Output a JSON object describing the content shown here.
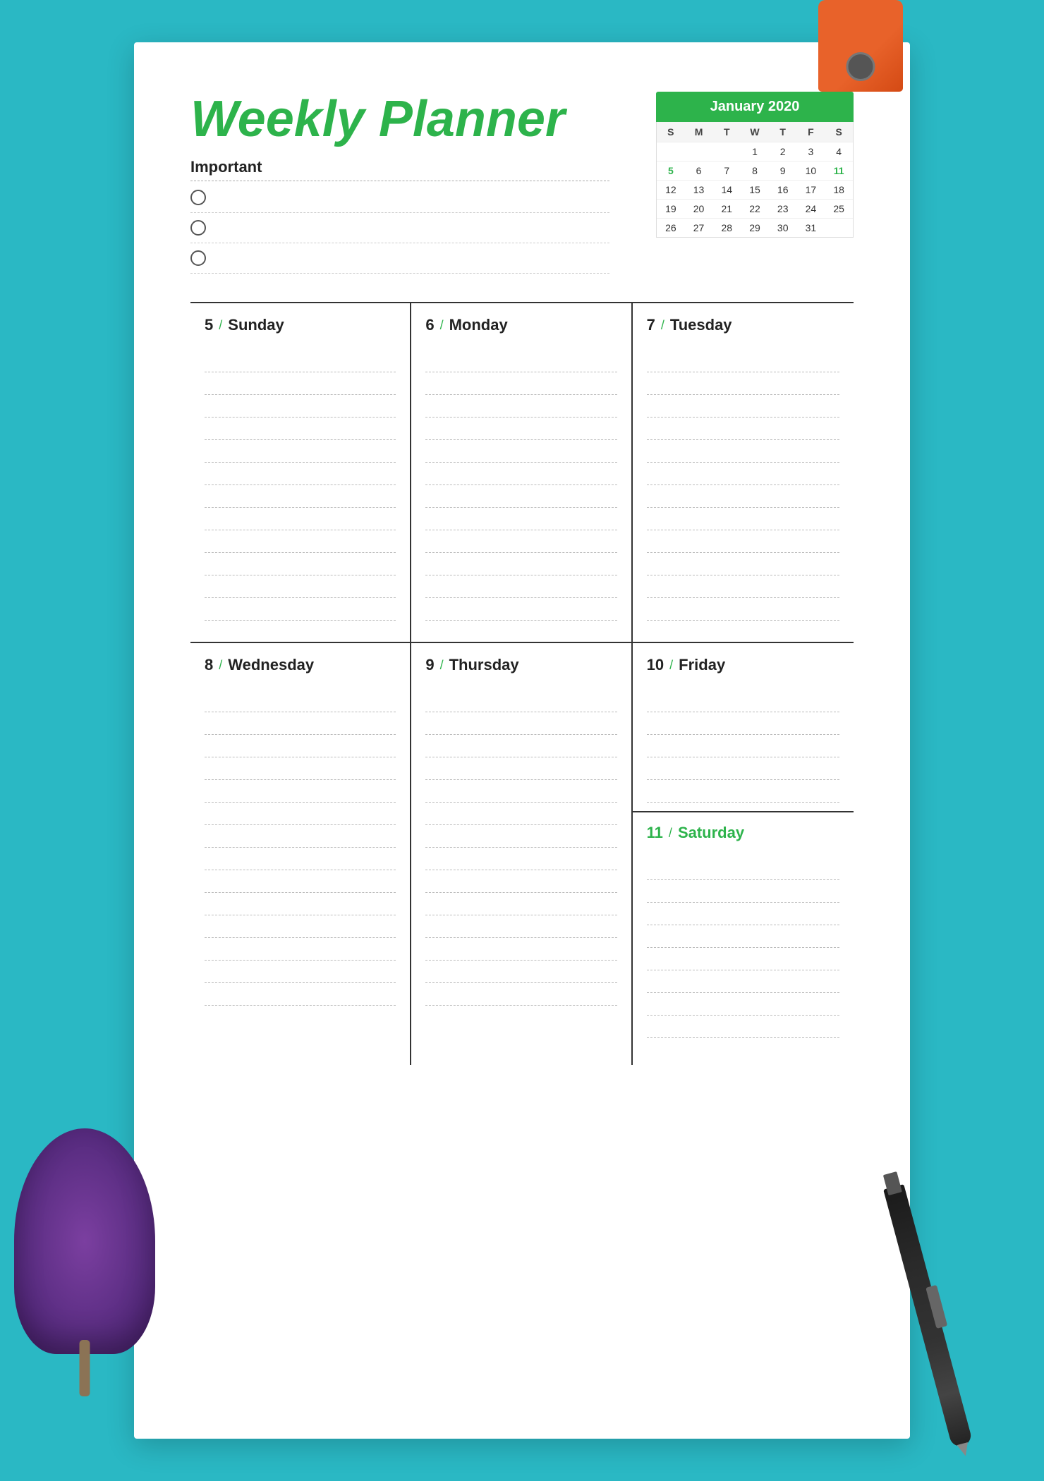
{
  "page": {
    "title": "Weekly Planner",
    "background_color": "#2ab8c4"
  },
  "header": {
    "title": "Weekly Planner",
    "important_label": "Important",
    "checkboxes": [
      {
        "id": 1,
        "checked": false
      },
      {
        "id": 2,
        "checked": false
      },
      {
        "id": 3,
        "checked": false
      }
    ]
  },
  "calendar": {
    "month_year": "January 2020",
    "day_labels": [
      "S",
      "M",
      "T",
      "W",
      "T",
      "F",
      "S"
    ],
    "weeks": [
      [
        "",
        "",
        "",
        "1",
        "2",
        "3",
        "4"
      ],
      [
        "5",
        "6",
        "7",
        "8",
        "9",
        "10",
        "11"
      ],
      [
        "12",
        "13",
        "14",
        "15",
        "16",
        "17",
        "18"
      ],
      [
        "19",
        "20",
        "21",
        "22",
        "23",
        "24",
        "25"
      ],
      [
        "26",
        "27",
        "28",
        "29",
        "30",
        "31",
        ""
      ]
    ],
    "highlighted_cells": [
      "5",
      "11"
    ]
  },
  "planner": {
    "row1": [
      {
        "day_number": "5",
        "day_name": "Sunday",
        "green": false,
        "lines": 12
      },
      {
        "day_number": "6",
        "day_name": "Monday",
        "green": false,
        "lines": 12
      },
      {
        "day_number": "7",
        "day_name": "Tuesday",
        "green": false,
        "lines": 12
      }
    ],
    "row2": [
      {
        "day_number": "8",
        "day_name": "Wednesday",
        "green": false,
        "lines": 14
      },
      {
        "day_number": "9",
        "day_name": "Thursday",
        "green": false,
        "lines": 14
      },
      {
        "friday": {
          "day_number": "10",
          "day_name": "Friday",
          "green": false,
          "lines": 5
        },
        "saturday": {
          "day_number": "11",
          "day_name": "Saturday",
          "green": true,
          "lines": 8
        }
      }
    ]
  }
}
